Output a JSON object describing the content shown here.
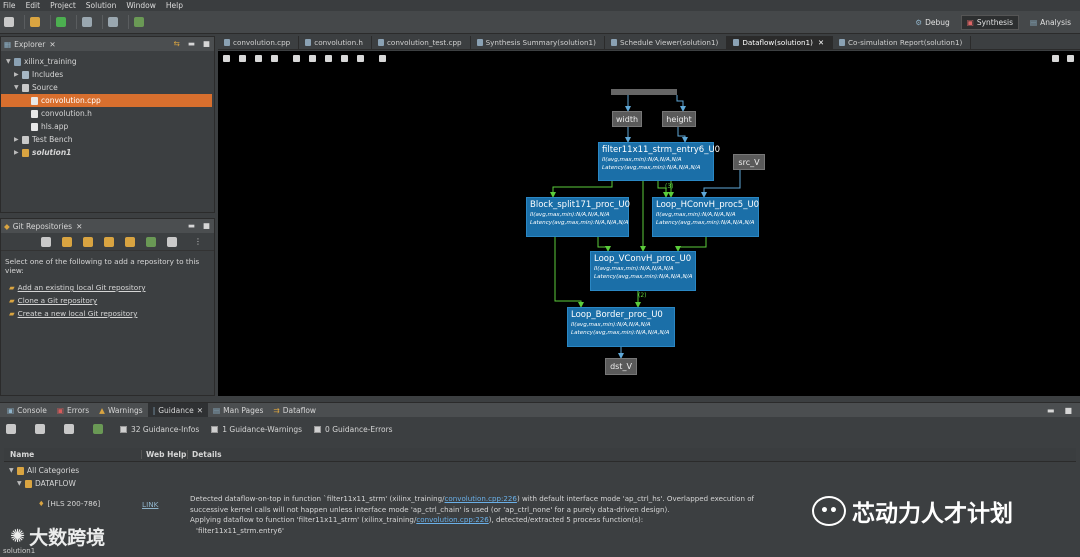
{
  "menu": [
    "File",
    "Edit",
    "Project",
    "Solution",
    "Window",
    "Help"
  ],
  "perspectives": [
    {
      "label": "Debug",
      "active": false
    },
    {
      "label": "Synthesis",
      "active": true
    },
    {
      "label": "Analysis",
      "active": false
    }
  ],
  "explorer": {
    "title": "Explorer",
    "project": "xilinx_training",
    "includes": "Includes",
    "source": "Source",
    "files": [
      "convolution.cpp",
      "convolution.h",
      "hls.app"
    ],
    "test_bench": "Test Bench",
    "solution": "solution1"
  },
  "git": {
    "title": "Git Repositories",
    "intro": "Select one of the following to add a repository to this view:",
    "links": [
      "Add an existing local Git repository",
      "Clone a Git repository",
      "Create a new local Git repository"
    ]
  },
  "editor_tabs": [
    {
      "label": "convolution.cpp",
      "active": false
    },
    {
      "label": "convolution.h",
      "active": false
    },
    {
      "label": "convolution_test.cpp",
      "active": false
    },
    {
      "label": "Synthesis Summary(solution1)",
      "active": false
    },
    {
      "label": "Schedule Viewer(solution1)",
      "active": false
    },
    {
      "label": "Dataflow(solution1)",
      "active": true
    },
    {
      "label": "Co-simulation Report(solution1)",
      "active": false
    }
  ],
  "dataflow": {
    "ports": {
      "width": "width",
      "height": "height",
      "src": "src_V",
      "dst": "dst_V"
    },
    "nodes": [
      {
        "title": "filter11x11_strm_entry6_U0",
        "ii": "II(avg,max,min):N/A,N/A,N/A",
        "lat": "Latency(avg,max,min):N/A,N/A,N/A"
      },
      {
        "title": "Block_split171_proc_U0",
        "ii": "II(avg,max,min):N/A,N/A,N/A",
        "lat": "Latency(avg,max,min):N/A,N/A,N/A"
      },
      {
        "title": "Loop_HConvH_proc5_U0",
        "ii": "II(avg,max,min):N/A,N/A,N/A",
        "lat": "Latency(avg,max,min):N/A,N/A,N/A"
      },
      {
        "title": "Loop_VConvH_proc_U0",
        "ii": "II(avg,max,min):N/A,N/A,N/A",
        "lat": "Latency(avg,max,min):N/A,N/A,N/A"
      },
      {
        "title": "Loop_Border_proc_U0",
        "ii": "II(avg,max,min):N/A,N/A,N/A",
        "lat": "Latency(avg,max,min):N/A,N/A,N/A"
      }
    ],
    "edge_labels": {
      "e1": "(3)",
      "e2": "(2)"
    }
  },
  "bottom_tabs": [
    {
      "label": "Console",
      "active": false
    },
    {
      "label": "Errors",
      "active": false
    },
    {
      "label": "Warnings",
      "active": false
    },
    {
      "label": "Guidance",
      "active": true
    },
    {
      "label": "Man Pages",
      "active": false
    },
    {
      "label": "Dataflow",
      "active": false
    }
  ],
  "guidance": {
    "infos": "32 Guidance-Infos",
    "warnings": "1 Guidance-Warnings",
    "errors": "0 Guidance-Errors",
    "columns": [
      "Name",
      "Web Help",
      "Details"
    ],
    "all_categories": "All Categories",
    "category": "DATAFLOW",
    "item_name": "[HLS 200-786]",
    "item_link": "LINK",
    "detail1_a": "Detected dataflow-on-top in function `filter11x11_strm' (xilinx_training/",
    "detail1_link": "convolution.cpp:226",
    "detail1_b": ") with default interface mode 'ap_ctrl_hs'. Overlapped execution of",
    "detail2": "successive kernel calls will not happen unless interface mode 'ap_ctrl_chain' is used (or 'ap_ctrl_none' for a purely data-driven design).",
    "detail3_a": "Applying dataflow to function 'filter11x11_strm' (xilinx_training/",
    "detail3_link": "convolution.cpp:226",
    "detail3_b": "), detected/extracted 5 process function(s):",
    "detail4": "'filter11x11_strm.entry6'"
  },
  "status": "solution1",
  "watermarks": {
    "left": "大数跨境",
    "right": "芯动力人才计划"
  }
}
